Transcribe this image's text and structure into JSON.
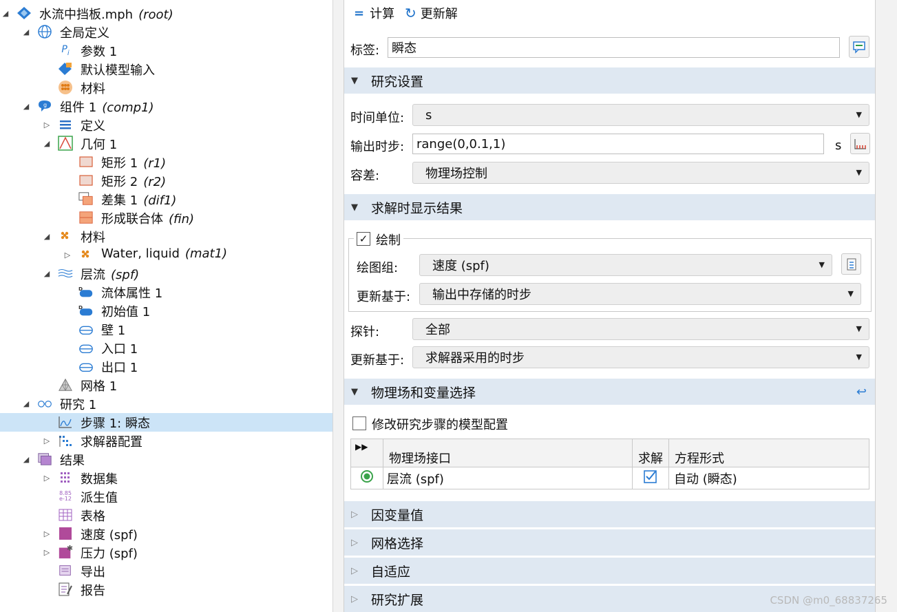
{
  "tree": {
    "items": [
      {
        "label": "水流中挡板.mph",
        "tag": "(root)",
        "icon": "model-diamond-icon",
        "toggle": "expanded"
      },
      {
        "label": "全局定义",
        "tag": "",
        "icon": "globe-icon",
        "toggle": "expanded"
      },
      {
        "label": "参数 1",
        "tag": "",
        "icon": "parameters-icon",
        "toggle": "none"
      },
      {
        "label": "默认模型输入",
        "tag": "",
        "icon": "model-input-icon",
        "toggle": "none"
      },
      {
        "label": "材料",
        "tag": "",
        "icon": "materials-icon",
        "toggle": "none"
      },
      {
        "label": "组件 1",
        "tag": "(comp1)",
        "icon": "component-icon",
        "toggle": "expanded"
      },
      {
        "label": "定义",
        "tag": "",
        "icon": "definitions-icon",
        "toggle": "collapsed"
      },
      {
        "label": "几何 1",
        "tag": "",
        "icon": "geometry-icon",
        "toggle": "expanded"
      },
      {
        "label": "矩形 1",
        "tag": "(r1)",
        "icon": "rectangle-icon",
        "toggle": "none"
      },
      {
        "label": "矩形 2",
        "tag": "(r2)",
        "icon": "rectangle-icon",
        "toggle": "none"
      },
      {
        "label": "差集 1",
        "tag": "(dif1)",
        "icon": "difference-icon",
        "toggle": "none"
      },
      {
        "label": "形成联合体",
        "tag": "(fin)",
        "icon": "form-union-icon",
        "toggle": "none"
      },
      {
        "label": "材料",
        "tag": "",
        "icon": "material-dots-icon",
        "toggle": "expanded"
      },
      {
        "label": "Water, liquid",
        "tag": "(mat1)",
        "icon": "material-dots-icon",
        "toggle": "collapsed"
      },
      {
        "label": "层流",
        "tag": "(spf)",
        "icon": "laminar-flow-icon",
        "toggle": "expanded"
      },
      {
        "label": "流体属性 1",
        "tag": "",
        "icon": "domain-feature-icon",
        "toggle": "none"
      },
      {
        "label": "初始值 1",
        "tag": "",
        "icon": "domain-feature-icon",
        "toggle": "none"
      },
      {
        "label": "壁 1",
        "tag": "",
        "icon": "boundary-feature-icon",
        "toggle": "none"
      },
      {
        "label": "入口 1",
        "tag": "",
        "icon": "boundary-feature-icon",
        "toggle": "none"
      },
      {
        "label": "出口 1",
        "tag": "",
        "icon": "boundary-feature-icon",
        "toggle": "none"
      },
      {
        "label": "网格 1",
        "tag": "",
        "icon": "mesh-icon",
        "toggle": "none"
      },
      {
        "label": "研究 1",
        "tag": "",
        "icon": "study-icon",
        "toggle": "expanded"
      },
      {
        "label": "步骤 1: 瞬态",
        "tag": "",
        "icon": "time-dependent-icon",
        "toggle": "none"
      },
      {
        "label": "求解器配置",
        "tag": "",
        "icon": "solver-config-icon",
        "toggle": "collapsed"
      },
      {
        "label": "结果",
        "tag": "",
        "icon": "results-icon",
        "toggle": "expanded"
      },
      {
        "label": "数据集",
        "tag": "",
        "icon": "datasets-icon",
        "toggle": "collapsed"
      },
      {
        "label": "派生值",
        "tag": "",
        "icon": "derived-values-icon",
        "toggle": "none"
      },
      {
        "label": "表格",
        "tag": "",
        "icon": "tables-icon",
        "toggle": "none"
      },
      {
        "label": "速度 (spf)",
        "tag": "",
        "icon": "plot-group-icon",
        "toggle": "collapsed"
      },
      {
        "label": "压力 (spf)",
        "tag": "",
        "icon": "plot-group-star-icon",
        "toggle": "collapsed"
      },
      {
        "label": "导出",
        "tag": "",
        "icon": "export-icon",
        "toggle": "none"
      },
      {
        "label": "报告",
        "tag": "",
        "icon": "report-icon",
        "toggle": "none"
      }
    ]
  },
  "toolbar": {
    "compute": "计算",
    "update_solution": "更新解"
  },
  "label_field": {
    "label": "标签:",
    "value": "瞬态"
  },
  "sections": {
    "study_settings": "研究设置",
    "results_while_solving": "求解时显示结果",
    "physics_selection": "物理场和变量选择",
    "dependent_values": "因变量值",
    "mesh_selection": "网格选择",
    "adaptation": "自适应",
    "study_extensions": "研究扩展"
  },
  "study_settings": {
    "time_unit_label": "时间单位:",
    "time_unit": "s",
    "output_times_label": "输出时步:",
    "output_times": "range(0,0.1,1)",
    "output_times_unit": "s",
    "tolerance_label": "容差:",
    "tolerance": "物理场控制"
  },
  "results_while_solving": {
    "plot_label": "绘制",
    "plot_checked": true,
    "plot_group_label": "绘图组:",
    "plot_group": "速度 (spf)",
    "update_at_label": "更新基于:",
    "update_at": "输出中存储的时步",
    "probes_label": "探针:",
    "probes": "全部",
    "probe_update_label": "更新基于:",
    "probe_update": "求解器采用的时步"
  },
  "physics_selection": {
    "modify_label": "修改研究步骤的模型配置",
    "columns": [
      "物理场接口",
      "求解",
      "方程形式"
    ],
    "rows": [
      {
        "interface": "层流 (spf)",
        "solve": true,
        "form": "自动 (瞬态)"
      }
    ]
  },
  "watermark": "CSDN @m0_68837265"
}
